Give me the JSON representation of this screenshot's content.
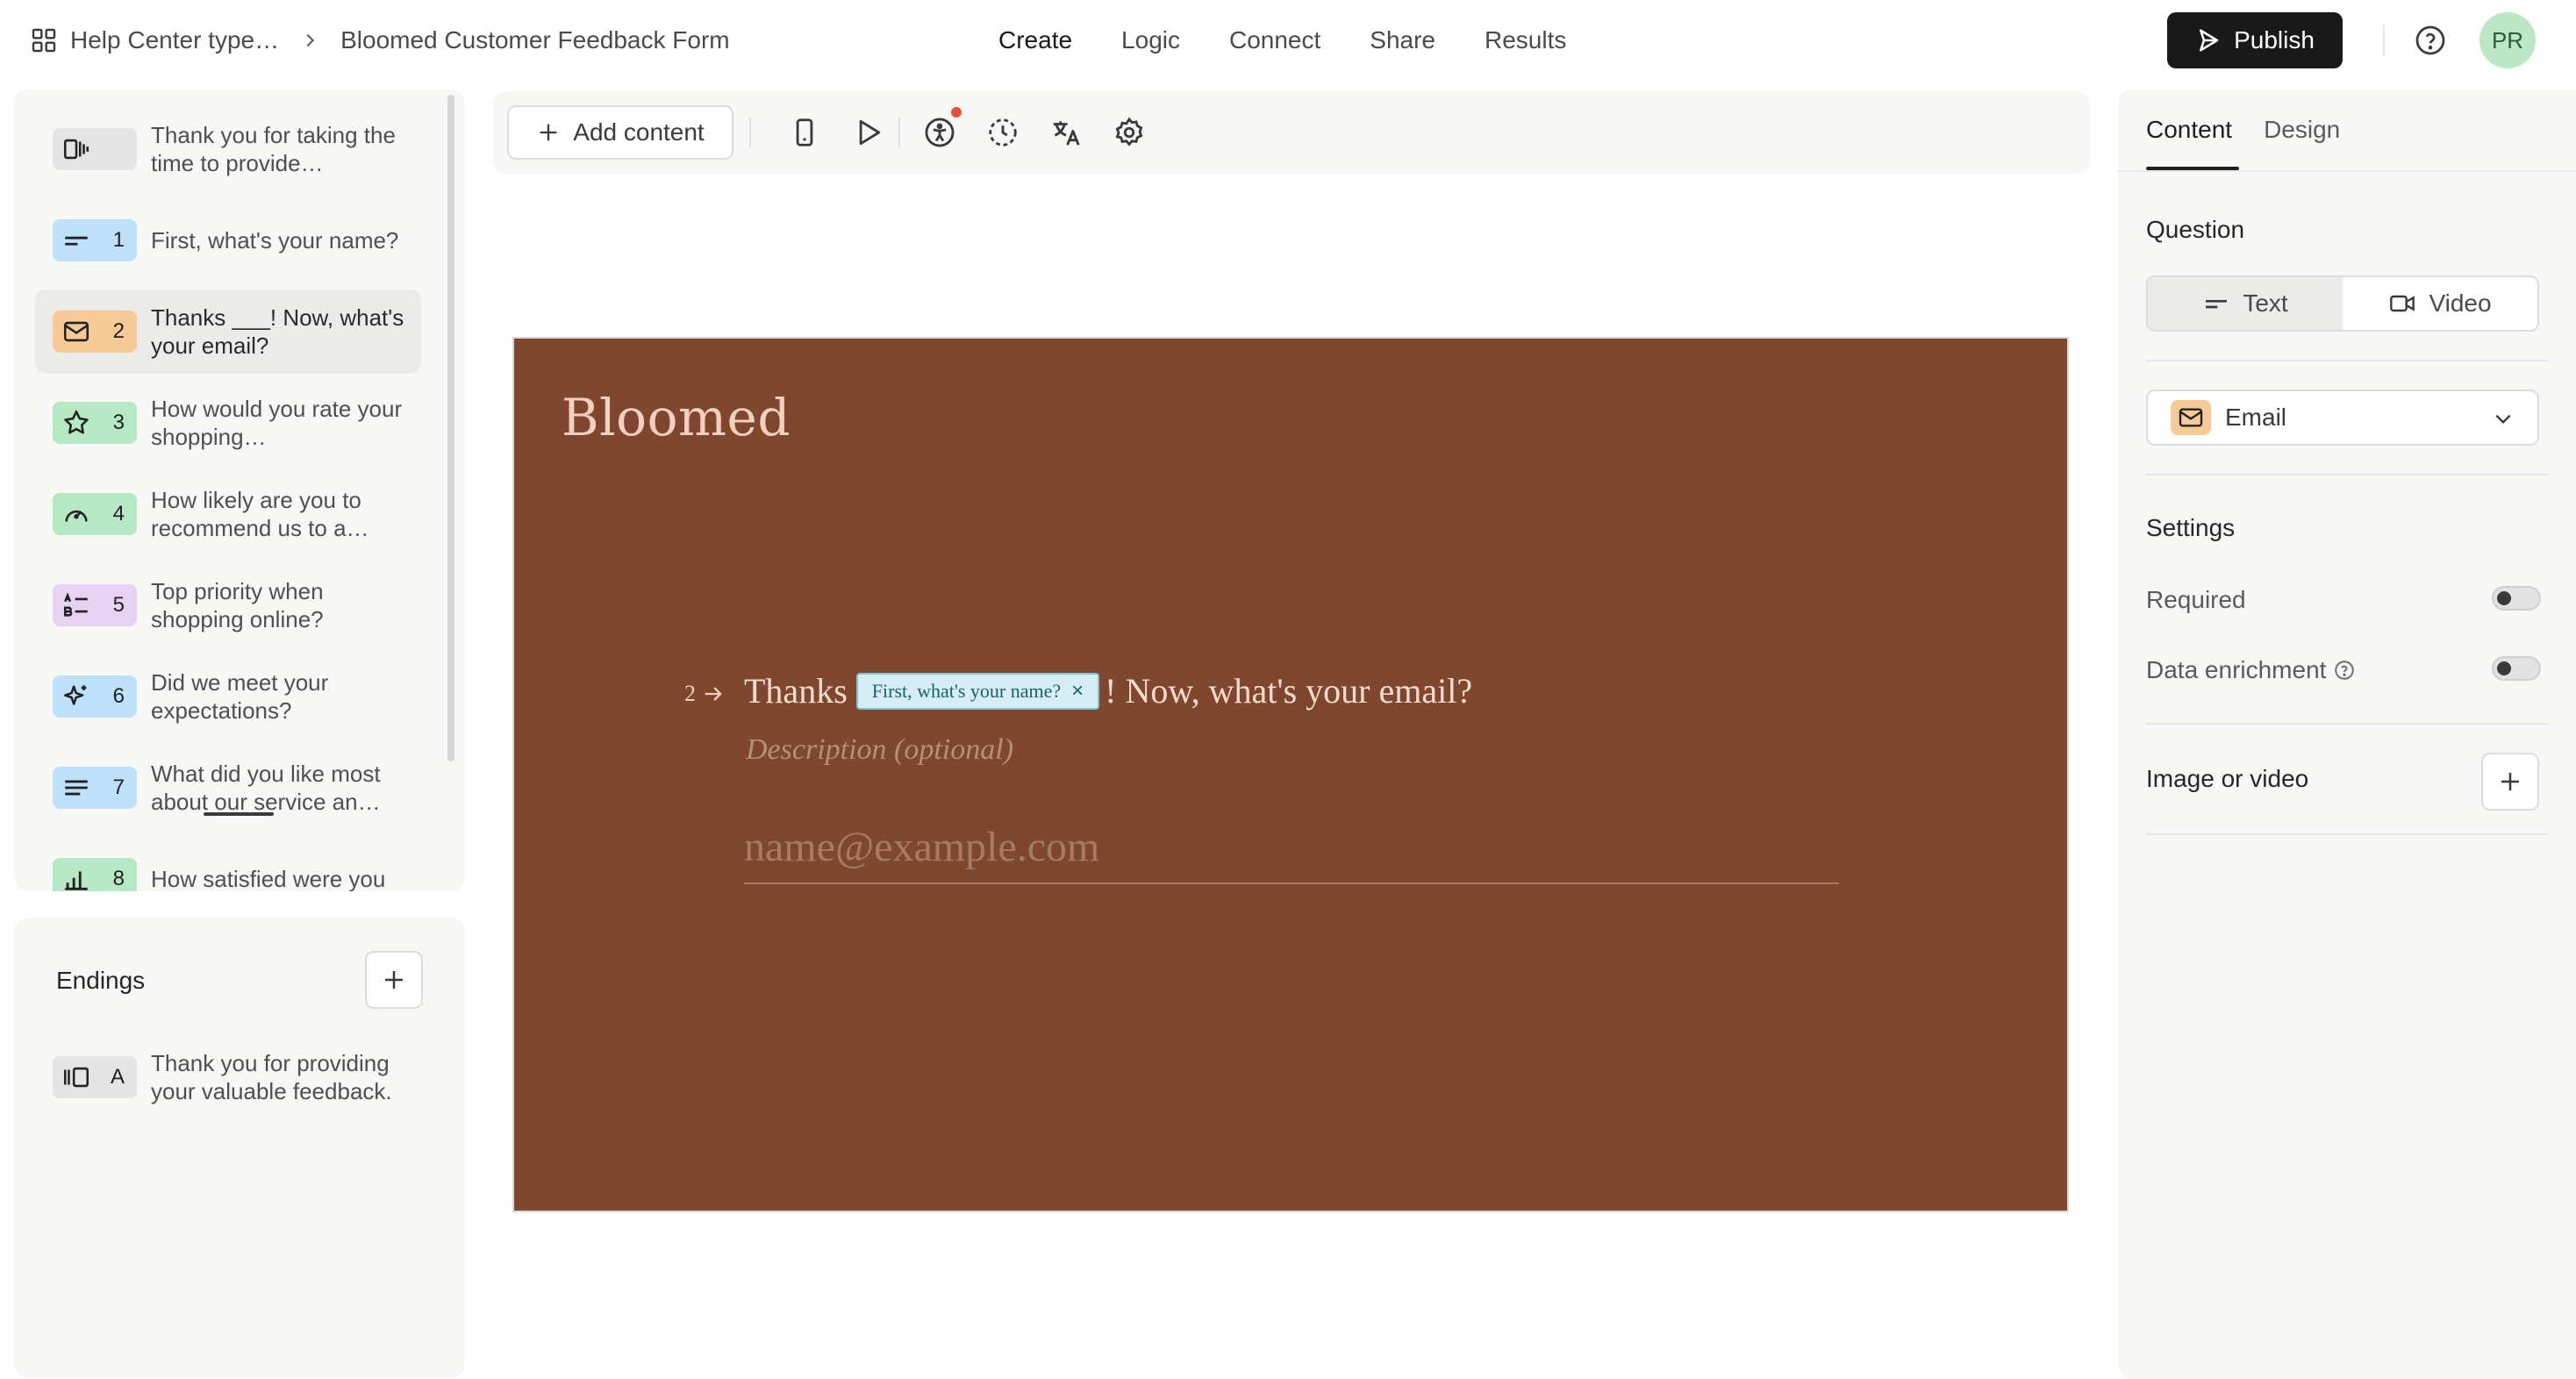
{
  "header": {
    "workspace": "Help Center type…",
    "form_title": "Bloomed Customer Feedback Form",
    "nav": [
      "Create",
      "Logic",
      "Connect",
      "Share",
      "Results"
    ],
    "active_nav": "Create",
    "publish_label": "Publish",
    "avatar_initials": "PR"
  },
  "questions": [
    {
      "num": "",
      "icon": "welcome-screen-icon",
      "color": "#e4e4e4",
      "label": "Thank you for taking the time to provide…"
    },
    {
      "num": "1",
      "icon": "short-text-icon",
      "color": "#bfe0fb",
      "label": "First, what's your name?"
    },
    {
      "num": "2",
      "icon": "email-icon",
      "color": "#f7c996",
      "label": "Thanks ___! Now, what's your email?"
    },
    {
      "num": "3",
      "icon": "star-icon",
      "color": "#b5e8c3",
      "label": "How would you rate your shopping…"
    },
    {
      "num": "4",
      "icon": "gauge-icon",
      "color": "#b5e8c3",
      "label": "How likely are you to recommend us to a…"
    },
    {
      "num": "5",
      "icon": "ranking-icon",
      "color": "#e8d2f3",
      "label": "Top priority when shopping online?"
    },
    {
      "num": "6",
      "icon": "sparkle-icon",
      "color": "#bfe0fb",
      "label": "Did we meet your expectations?"
    },
    {
      "num": "7",
      "icon": "long-text-icon",
      "color": "#bfe0fb",
      "label": "What did you like most about our service an…"
    },
    {
      "num": "8",
      "icon": "bar-chart-icon",
      "color": "#b5e8c3",
      "label": "How satisfied were you"
    }
  ],
  "selected_question": "2",
  "endings": {
    "title": "Endings",
    "items": [
      {
        "num": "A",
        "icon": "ending-screen-icon",
        "color": "#e4e4e4",
        "label": "Thank you for providing your valuable feedback."
      }
    ]
  },
  "toolbar": {
    "add_content_label": "Add content"
  },
  "preview": {
    "brand": "Bloomed",
    "question_number": "2",
    "title_before": "Thanks",
    "recall_chip": "First, what's your name?",
    "title_after": "! Now, what's your email?",
    "description_placeholder": "Description (optional)",
    "input_placeholder": "name@example.com",
    "background_color": "#7f472d"
  },
  "right_panel": {
    "tabs": [
      "Content",
      "Design"
    ],
    "active_tab": "Content",
    "question_label": "Question",
    "question_modes": [
      "Text",
      "Video"
    ],
    "active_mode": "Text",
    "question_type": "Email",
    "settings_label": "Settings",
    "required_label": "Required",
    "required_on": false,
    "enrichment_label": "Data enrichment",
    "enrichment_on": false,
    "media_label": "Image or video"
  }
}
